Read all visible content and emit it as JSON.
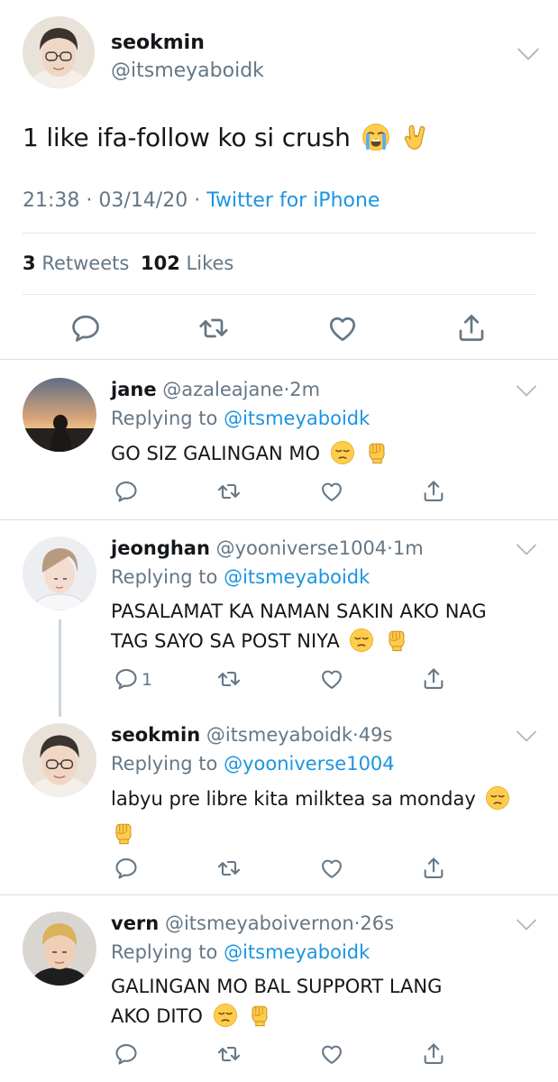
{
  "main_tweet": {
    "display_name": "seokmin",
    "handle": "@itsmeyaboidk",
    "text": "1 like ifa-follow ko si crush",
    "emojis": [
      "loudly-crying-face",
      "sign-of-the-horns"
    ],
    "time": "21:38",
    "date": "03/14/20",
    "separator": "·",
    "source": "Twitter for iPhone",
    "retweet_count": "3",
    "retweets_label": "Retweets",
    "like_count": "102",
    "likes_label": "Likes"
  },
  "replies": [
    {
      "display_name": "jane",
      "handle": "@azaleajane",
      "time": "2m",
      "replying_label": "Replying to",
      "replying_to": "@itsmeyaboidk",
      "text": "GO SIZ GALINGAN MO",
      "emojis": [
        "pensive-face",
        "raised-fist"
      ],
      "reply_count": ""
    },
    {
      "display_name": "jeonghan",
      "handle": "@yooniverse1004",
      "time": "1m",
      "replying_label": "Replying to",
      "replying_to": "@itsmeyaboidk",
      "text_line1": "PASALAMAT KA NAMAN SAKIN AKO NAG",
      "text_line2": "TAG SAYO SA POST NIYA",
      "emojis": [
        "pensive-face",
        "raised-fist"
      ],
      "reply_count": "1"
    },
    {
      "display_name": "seokmin",
      "handle": "@itsmeyaboidk",
      "time": "49s",
      "replying_label": "Replying to",
      "replying_to": "@yooniverse1004",
      "text": "labyu pre libre kita milktea sa monday",
      "emojis": [
        "pensive-face",
        "raised-fist"
      ],
      "reply_count": ""
    },
    {
      "display_name": "vern",
      "handle": "@itsmeyaboivernon",
      "time": "26s",
      "replying_label": "Replying to",
      "replying_to": "@itsmeyaboidk",
      "text_line1": "GALINGAN MO BAL SUPPORT LANG",
      "text_line2": "AKO DITO",
      "emojis": [
        "pensive-face",
        "raised-fist"
      ],
      "reply_count": ""
    }
  ],
  "colors": {
    "link": "#1b95e0",
    "secondary_text": "#657786",
    "primary_text": "#14171a",
    "divider": "#e1e8ed"
  }
}
